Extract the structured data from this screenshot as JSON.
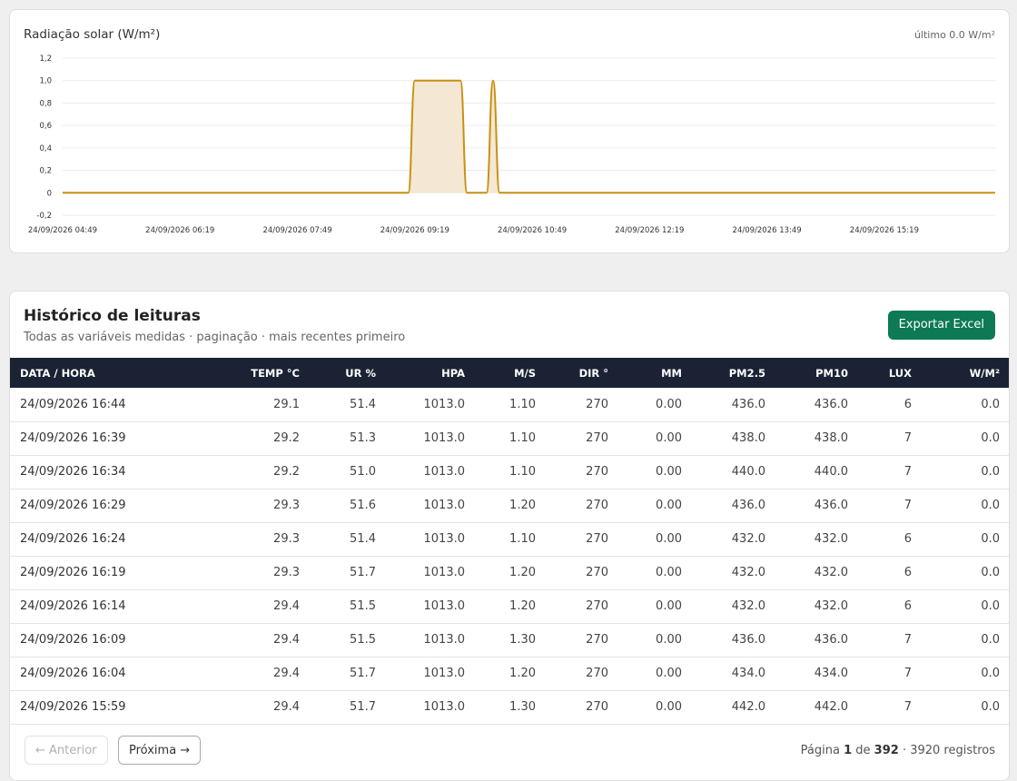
{
  "chart_card": {
    "title": "Radiação solar (W/m²)",
    "latest": "último 0.0 W/m²"
  },
  "chart_data": {
    "type": "area",
    "series": [
      {
        "color": "#c8900f",
        "fill": "#f4e8d4",
        "points": [
          {
            "x": "24/09/2026 04:49",
            "y": 0
          },
          {
            "x": "24/09/2026 09:14",
            "y": 0
          },
          {
            "x": "24/09/2026 09:19",
            "y": 1
          },
          {
            "x": "24/09/2026 09:54",
            "y": 1
          },
          {
            "x": "24/09/2026 09:59",
            "y": 0
          },
          {
            "x": "24/09/2026 10:14",
            "y": 0
          },
          {
            "x": "24/09/2026 10:19",
            "y": 1
          },
          {
            "x": "24/09/2026 10:24",
            "y": 0
          },
          {
            "x": "24/09/2026 16:44",
            "y": 0
          }
        ]
      }
    ],
    "xticks": [
      "24/09/2026 04:49",
      "24/09/2026 06:19",
      "24/09/2026 07:49",
      "24/09/2026 09:19",
      "24/09/2026 10:49",
      "24/09/2026 12:19",
      "24/09/2026 13:49",
      "24/09/2026 15:19"
    ],
    "yticks": [
      "1,2",
      "1,0",
      "0,8",
      "0,6",
      "0,4",
      "0,2",
      "0",
      "-0,2"
    ],
    "ylim": [
      -0.2,
      1.2
    ],
    "grid": true,
    "legend": "none"
  },
  "history": {
    "title": "Histórico de leituras",
    "subtitle": "Todas as variáveis medidas · paginação · mais recentes primeiro",
    "export_label": "Exportar Excel",
    "columns": [
      "DATA / HORA",
      "TEMP °C",
      "UR %",
      "HPA",
      "M/S",
      "DIR °",
      "MM",
      "PM2.5",
      "PM10",
      "LUX",
      "W/M²"
    ],
    "rows": [
      [
        "24/09/2026 16:44",
        "29.1",
        "51.4",
        "1013.0",
        "1.10",
        "270",
        "0.00",
        "436.0",
        "436.0",
        "6",
        "0.0"
      ],
      [
        "24/09/2026 16:39",
        "29.2",
        "51.3",
        "1013.0",
        "1.10",
        "270",
        "0.00",
        "438.0",
        "438.0",
        "7",
        "0.0"
      ],
      [
        "24/09/2026 16:34",
        "29.2",
        "51.0",
        "1013.0",
        "1.10",
        "270",
        "0.00",
        "440.0",
        "440.0",
        "7",
        "0.0"
      ],
      [
        "24/09/2026 16:29",
        "29.3",
        "51.6",
        "1013.0",
        "1.20",
        "270",
        "0.00",
        "436.0",
        "436.0",
        "7",
        "0.0"
      ],
      [
        "24/09/2026 16:24",
        "29.3",
        "51.4",
        "1013.0",
        "1.10",
        "270",
        "0.00",
        "432.0",
        "432.0",
        "6",
        "0.0"
      ],
      [
        "24/09/2026 16:19",
        "29.3",
        "51.7",
        "1013.0",
        "1.20",
        "270",
        "0.00",
        "432.0",
        "432.0",
        "6",
        "0.0"
      ],
      [
        "24/09/2026 16:14",
        "29.4",
        "51.5",
        "1013.0",
        "1.20",
        "270",
        "0.00",
        "432.0",
        "432.0",
        "6",
        "0.0"
      ],
      [
        "24/09/2026 16:09",
        "29.4",
        "51.5",
        "1013.0",
        "1.30",
        "270",
        "0.00",
        "436.0",
        "436.0",
        "7",
        "0.0"
      ],
      [
        "24/09/2026 16:04",
        "29.4",
        "51.7",
        "1013.0",
        "1.20",
        "270",
        "0.00",
        "434.0",
        "434.0",
        "7",
        "0.0"
      ],
      [
        "24/09/2026 15:59",
        "29.4",
        "51.7",
        "1013.0",
        "1.30",
        "270",
        "0.00",
        "442.0",
        "442.0",
        "7",
        "0.0"
      ]
    ],
    "pagination": {
      "prev_label": "← Anterior",
      "next_label": "Próxima →",
      "page_word": "Página",
      "page": "1",
      "of_word": "de",
      "total_pages": "392",
      "records": "· 3920 registros"
    }
  }
}
